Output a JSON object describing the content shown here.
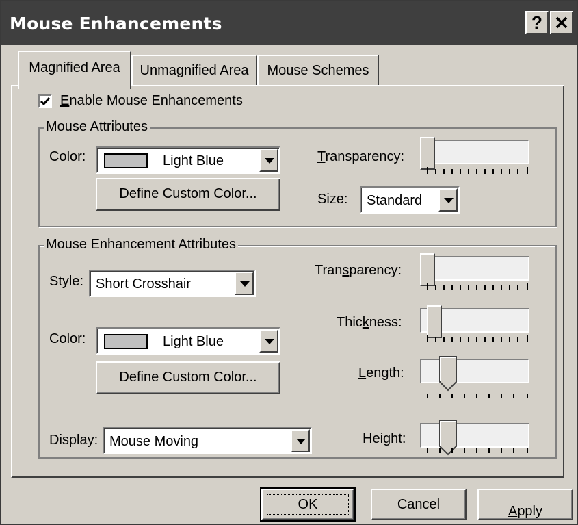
{
  "window": {
    "title": "Mouse Enhancements",
    "help_icon": "question-mark-icon",
    "close_icon": "close-icon"
  },
  "tabs": [
    {
      "label": "Magnified Area",
      "active": true
    },
    {
      "label": "Unmagnified Area",
      "active": false
    },
    {
      "label": "Mouse Schemes",
      "active": false
    }
  ],
  "enable": {
    "label_prefix": "E",
    "label_rest": "nable Mouse Enhancements",
    "checked": true
  },
  "mouse_attributes": {
    "title": "Mouse Attributes",
    "color_label": "Color:",
    "color_value": "Light Blue",
    "define_button": "Define Custom Color...",
    "transparency_label_u": "T",
    "transparency_label_rest": "ransparency:",
    "transparency_value": 0,
    "size_label": "Size:",
    "size_value": "Standard"
  },
  "enhancement_attributes": {
    "title": "Mouse Enhancement Attributes",
    "style_label": "Style:",
    "style_value": "Short Crosshair",
    "transparency_label_a": "Tran",
    "transparency_label_u": "s",
    "transparency_label_b": "parency:",
    "transparency_value": 0,
    "color_label": "Color:",
    "color_value": "Light Blue",
    "define_button": "Define Custom Color...",
    "thickness_label_a": "Thic",
    "thickness_label_u": "k",
    "thickness_label_b": "ness:",
    "thickness_value": 0,
    "length_label_u": "L",
    "length_label_rest": "ength:",
    "length_value": 2,
    "height_label": "Height:",
    "height_value": 2,
    "display_label": "Display:",
    "display_value": "Mouse Moving"
  },
  "footer": {
    "ok": "OK",
    "cancel": "Cancel",
    "apply_u": "A",
    "apply_rest": "pply"
  },
  "colors": {
    "titlebar": "#3f3f3f",
    "face": "#d4d0c8",
    "swatch": "#c0c0c0"
  }
}
